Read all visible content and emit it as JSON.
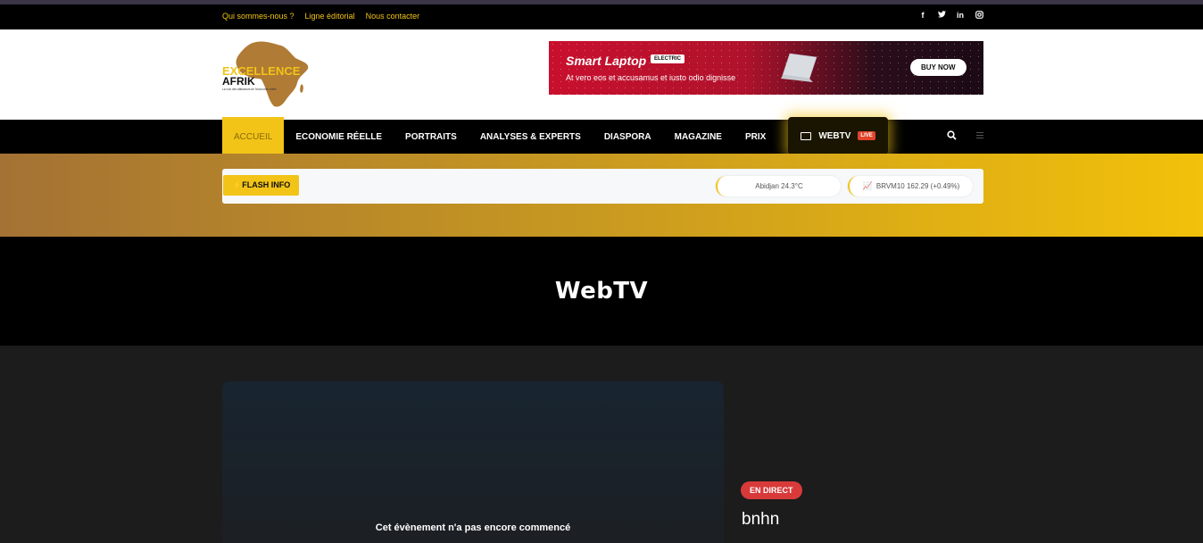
{
  "topbar": {
    "links": [
      "Qui sommes-nous ?",
      "Ligne éditorial",
      "Nous contacter"
    ],
    "social": [
      "facebook-icon",
      "twitter-icon",
      "linkedin-icon",
      "instagram-icon"
    ]
  },
  "logo": {
    "line1": "EXCELLENCE",
    "line2": "AFRIK",
    "tagline": "La voix des bâtisseurs de l'économie réelle"
  },
  "ad": {
    "title": "Smart Laptop",
    "badge": "ELECTRIC",
    "subtitle": "At vero eos et accusamus et iusto odio dignisse",
    "cta": "BUY NOW"
  },
  "nav": {
    "items": [
      "ACCUEIL",
      "ECONOMIE RÉELLE",
      "PORTRAITS",
      "ANALYSES & EXPERTS",
      "DIASPORA",
      "MAGAZINE",
      "PRIX"
    ],
    "webtv_label": "WEBTV",
    "live_label": "LIVE"
  },
  "ticker": {
    "flash_label": "FLASH INFO",
    "weather": "Abidjan 24.3°C",
    "bourse": "BRVM10 162.29 (+0.49%)"
  },
  "hero": {
    "title": "WebTV"
  },
  "player": {
    "message": "Cet évènement n'a pas encore commencé"
  },
  "event": {
    "status": "EN DIRECT",
    "title": "bnhn"
  },
  "colors": {
    "accent": "#f2c418",
    "live": "#d83a3a",
    "nav_bg": "#000000"
  }
}
